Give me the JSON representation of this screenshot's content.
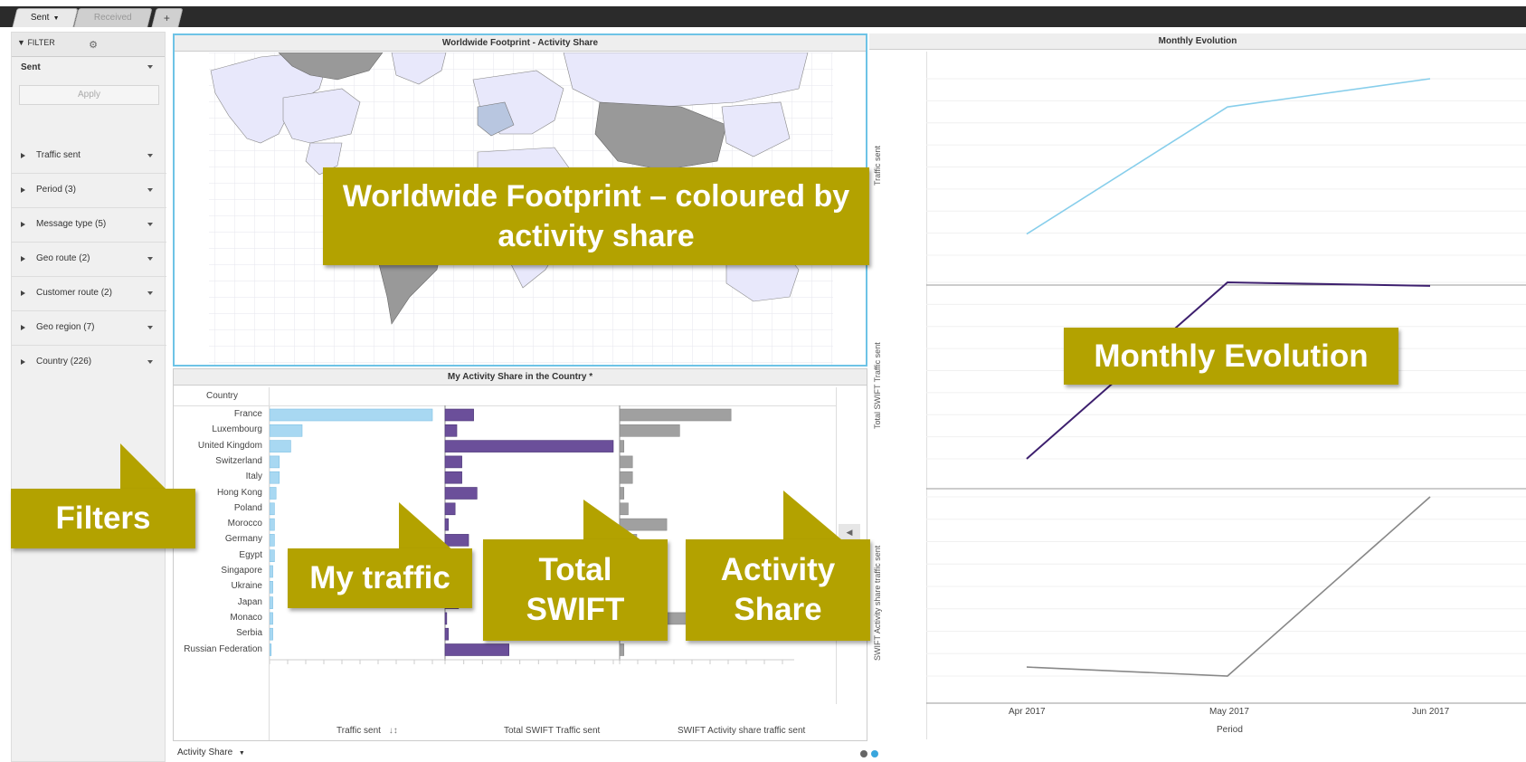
{
  "tabs": [
    {
      "label": "Sent"
    },
    {
      "label": "Received"
    },
    {
      "label": "+"
    }
  ],
  "sidebar": {
    "filter_label": "FILTER",
    "sent_value": "Sent",
    "apply_label": "Apply",
    "items": [
      {
        "label": "Traffic sent"
      },
      {
        "label": "Period (3)"
      },
      {
        "label": "Message type (5)"
      },
      {
        "label": "Geo route (2)"
      },
      {
        "label": "Customer route (2)"
      },
      {
        "label": "Geo region (7)"
      },
      {
        "label": "Country (226)"
      }
    ]
  },
  "map_panel": {
    "title": "Worldwide Footprint - Activity Share"
  },
  "bar_panel": {
    "title": "My Activity Share in the Country *",
    "column_header": "Country",
    "countries": [
      "France",
      "Luxembourg",
      "United Kingdom",
      "Switzerland",
      "Italy",
      "Hong Kong",
      "Poland",
      "Morocco",
      "Germany",
      "Egypt",
      "Singapore",
      "Ukraine",
      "Japan",
      "Monaco",
      "Serbia",
      "Russian Federation"
    ],
    "x_labels": [
      "Traffic sent",
      "Total SWIFT Traffic sent",
      "SWIFT Activity share traffic sent"
    ],
    "sort_icon": "↓↕",
    "footer_label": "Activity Share"
  },
  "monthly_panel": {
    "title": "Monthly Evolution",
    "y_labels": [
      "Traffic sent",
      "Total SWIFT Traffic sent",
      "SWIFT Activity share traffic sent"
    ],
    "x_ticks": [
      "Apr 2017",
      "May 2017",
      "Jun 2017"
    ],
    "x_title": "Period"
  },
  "chart_data": [
    {
      "type": "bar",
      "categories": [
        "France",
        "Luxembourg",
        "United Kingdom",
        "Switzerland",
        "Italy",
        "Hong Kong",
        "Poland",
        "Morocco",
        "Germany",
        "Egypt",
        "Singapore",
        "Ukraine",
        "Japan",
        "Monaco",
        "Serbia",
        "Russian Federation"
      ],
      "series": [
        {
          "name": "Traffic sent",
          "color": "#a8d8f2",
          "values": [
            100,
            20,
            13,
            6,
            6,
            4,
            3,
            3,
            3,
            3,
            2,
            2,
            2,
            2,
            2,
            1
          ]
        },
        {
          "name": "Total SWIFT Traffic sent",
          "color": "#6b4f9a",
          "values": [
            17,
            7,
            100,
            10,
            10,
            19,
            6,
            2,
            14,
            3,
            10,
            4,
            8,
            1,
            2,
            38
          ]
        },
        {
          "name": "SWIFT Activity share traffic sent",
          "color": "#a0a0a0",
          "values": [
            26,
            14,
            1,
            3,
            3,
            1,
            2,
            11,
            4,
            4,
            6,
            2,
            1,
            38,
            5,
            1
          ]
        }
      ]
    },
    {
      "type": "line",
      "x": [
        "Apr 2017",
        "May 2017",
        "Jun 2017"
      ],
      "series": [
        {
          "name": "Traffic sent",
          "color": "#87ceeb",
          "values": [
            0.12,
            0.84,
            1.0
          ]
        },
        {
          "name": "Total SWIFT Traffic sent",
          "color": "#3d1f6e",
          "values": [
            0.0,
            1.0,
            0.98
          ]
        },
        {
          "name": "SWIFT Activity share traffic sent",
          "color": "#888888",
          "values": [
            0.05,
            0.0,
            1.0
          ]
        }
      ]
    }
  ],
  "callouts": {
    "map": "Worldwide Footprint – coloured by activity share",
    "monthly": "Monthly Evolution",
    "filters": "Filters",
    "my_traffic": "My traffic",
    "total_swift": "Total SWIFT",
    "activity_share": "Activity Share"
  },
  "colors": {
    "callout_bg": "#b3a200",
    "map_border": "#6ec3e6",
    "light_blue": "#a8d8f2",
    "purple": "#6b4f9a",
    "gray": "#a0a0a0"
  }
}
